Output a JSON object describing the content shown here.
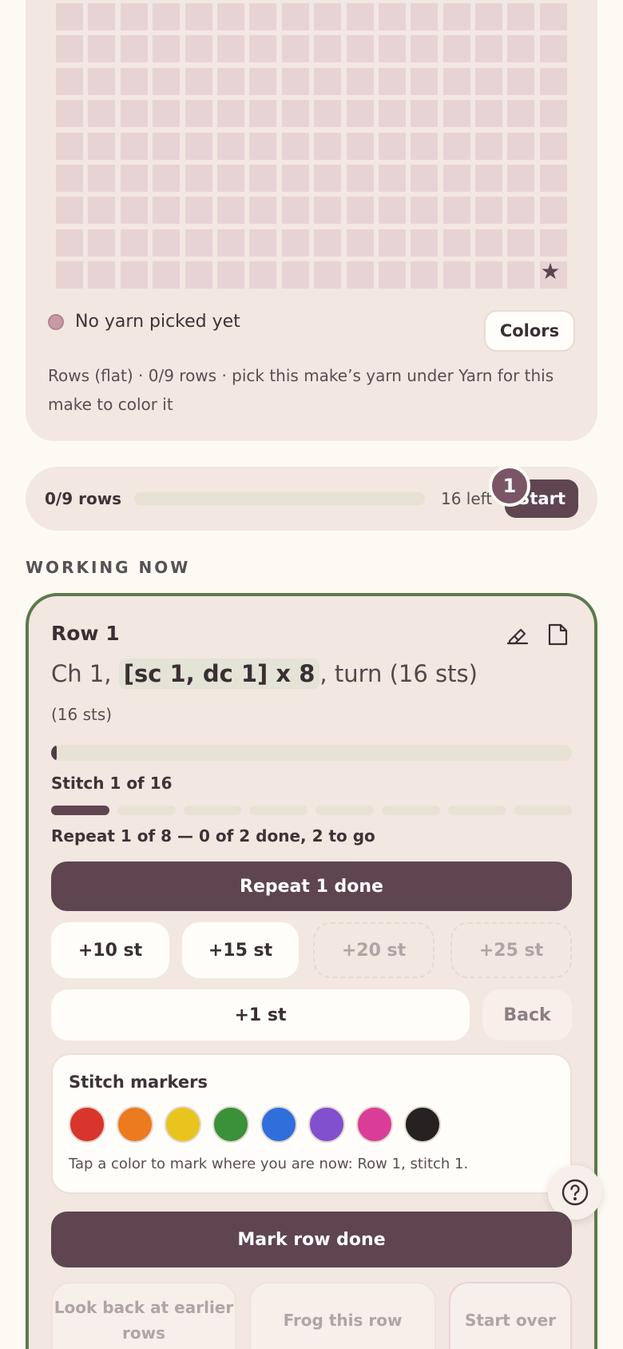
{
  "pattern": {
    "star_icon": "star-icon",
    "yarn_status": "No yarn picked yet",
    "colors_label": "Colors",
    "note": "Rows (flat) · 0/9 rows · pick this make’s yarn under Yarn for this make to color it"
  },
  "progress": {
    "rows_label": "0/9 rows",
    "fraction_done": 0,
    "left_label": "16 left",
    "start_label": "Start",
    "badge": "1"
  },
  "section": {
    "working_now": "WORKING NOW"
  },
  "row": {
    "title": "Row 1",
    "edit_icon": "pencil-eraser-icon",
    "note_icon": "note-icon",
    "instruction_before": "Ch 1, ",
    "instruction_highlight": "[sc 1, dc 1] x 8",
    "instruction_after": ", turn (16 sts)",
    "sts": "(16 sts)",
    "stitch_label": "Stitch 1 of 16",
    "stitch_fraction": 0.0625,
    "repeat_segments": 8,
    "repeat_current": 1,
    "repeat_label": "Repeat 1 of 8 — 0 of 2 done, 2 to go",
    "repeat_done_label": "Repeat 1 done",
    "steps": [
      "+10 st",
      "+15 st",
      "+20 st",
      "+25 st"
    ],
    "plus_one_label": "+1 st",
    "back_label": "Back",
    "markers": {
      "title": "Stitch markers",
      "colors": [
        "#d8352c",
        "#ec7a1e",
        "#e8c51e",
        "#3a913a",
        "#2f6fdc",
        "#8150cf",
        "#d93d98",
        "#262222"
      ],
      "hint": "Tap a color to mark where you are now: Row 1, stitch 1."
    },
    "mark_row_done_label": "Mark row done",
    "look_back_label": "Look back at earlier rows",
    "frog_label": "Frog this row",
    "start_over_label": "Start over"
  },
  "help_icon": "help-icon"
}
